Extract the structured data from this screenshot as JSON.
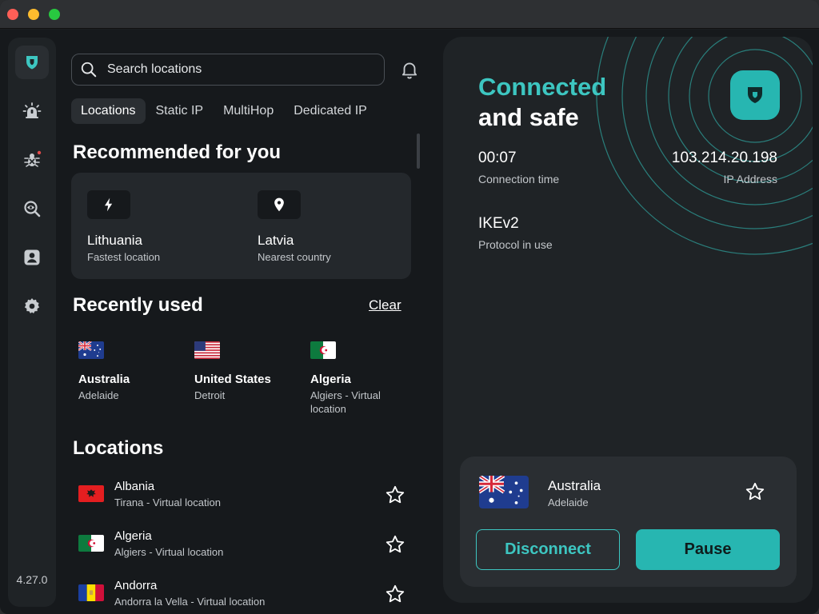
{
  "colors": {
    "accent": "#3dc6c1",
    "accent_button": "#27b6b1",
    "panel": "#1f2326",
    "background": "#16191c"
  },
  "sidebar": {
    "items": [
      {
        "name": "shield",
        "icon": "shield-icon"
      },
      {
        "name": "threat-alert",
        "icon": "alarm-icon"
      },
      {
        "name": "malware",
        "icon": "bug-icon"
      },
      {
        "name": "dark-web-monitor",
        "icon": "eye-search-icon"
      },
      {
        "name": "account",
        "icon": "user-icon"
      },
      {
        "name": "settings",
        "icon": "gear-icon"
      }
    ],
    "version": "4.27.0"
  },
  "search": {
    "placeholder": "Search locations"
  },
  "tabs": [
    {
      "label": "Locations",
      "active": true
    },
    {
      "label": "Static IP",
      "active": false
    },
    {
      "label": "MultiHop",
      "active": false
    },
    {
      "label": "Dedicated IP",
      "active": false
    }
  ],
  "recommended": {
    "title": "Recommended for you",
    "items": [
      {
        "icon": "bolt-icon",
        "name": "Lithuania",
        "sub": "Fastest location"
      },
      {
        "icon": "pin-icon",
        "name": "Latvia",
        "sub": "Nearest country"
      }
    ]
  },
  "recent": {
    "title": "Recently used",
    "clear_label": "Clear",
    "items": [
      {
        "flag": "au",
        "name": "Australia",
        "sub": "Adelaide"
      },
      {
        "flag": "us",
        "name": "United States",
        "sub": "Detroit"
      },
      {
        "flag": "dz",
        "name": "Algeria",
        "sub": "Algiers - Virtual location"
      }
    ]
  },
  "locations": {
    "title": "Locations",
    "items": [
      {
        "flag": "al",
        "name": "Albania",
        "sub": "Tirana - Virtual location"
      },
      {
        "flag": "dz",
        "name": "Algeria",
        "sub": "Algiers - Virtual location"
      },
      {
        "flag": "ad",
        "name": "Andorra",
        "sub": "Andorra la Vella - Virtual location"
      }
    ]
  },
  "status": {
    "title_accent": "Connected",
    "title_rest": "and safe",
    "connection_time": "00:07",
    "connection_time_label": "Connection time",
    "ip": "103.214.20.198",
    "ip_label": "IP Address",
    "protocol": "IKEv2",
    "protocol_label": "Protocol in use"
  },
  "connection": {
    "flag": "au",
    "name": "Australia",
    "sub": "Adelaide",
    "disconnect_label": "Disconnect",
    "pause_label": "Pause"
  }
}
